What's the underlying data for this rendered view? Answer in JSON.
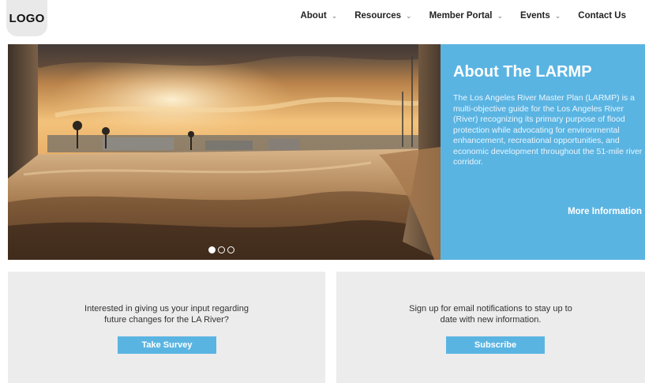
{
  "header": {
    "logo": "LOGO",
    "nav": [
      {
        "label": "About",
        "has_dropdown": true
      },
      {
        "label": "Resources",
        "has_dropdown": true
      },
      {
        "label": "Member Portal",
        "has_dropdown": true
      },
      {
        "label": "Events",
        "has_dropdown": true
      },
      {
        "label": "Contact Us",
        "has_dropdown": false
      }
    ],
    "chevron": "⌄"
  },
  "hero": {
    "title": "About The LARMP",
    "body": "The Los Angeles River Master Plan (LARMP) is a multi-objective guide for the Los Angeles River (River) recognizing its primary purpose of flood protection while advocating for environmental enhancement, recreational opportunities, and economic development throughout the 51-mile river corridor.",
    "link": "More Information",
    "slides": 3,
    "active_slide": 1,
    "accent": "#5ab4e2"
  },
  "cards": {
    "survey": {
      "text_line1": "Interested in giving us your input regarding",
      "text_line2": "future changes for the LA River?",
      "button": "Take Survey"
    },
    "subscribe": {
      "text_line1": "Sign up for email notifications to stay up to",
      "text_line2": "date with new information.",
      "button": "Subscribe"
    }
  }
}
